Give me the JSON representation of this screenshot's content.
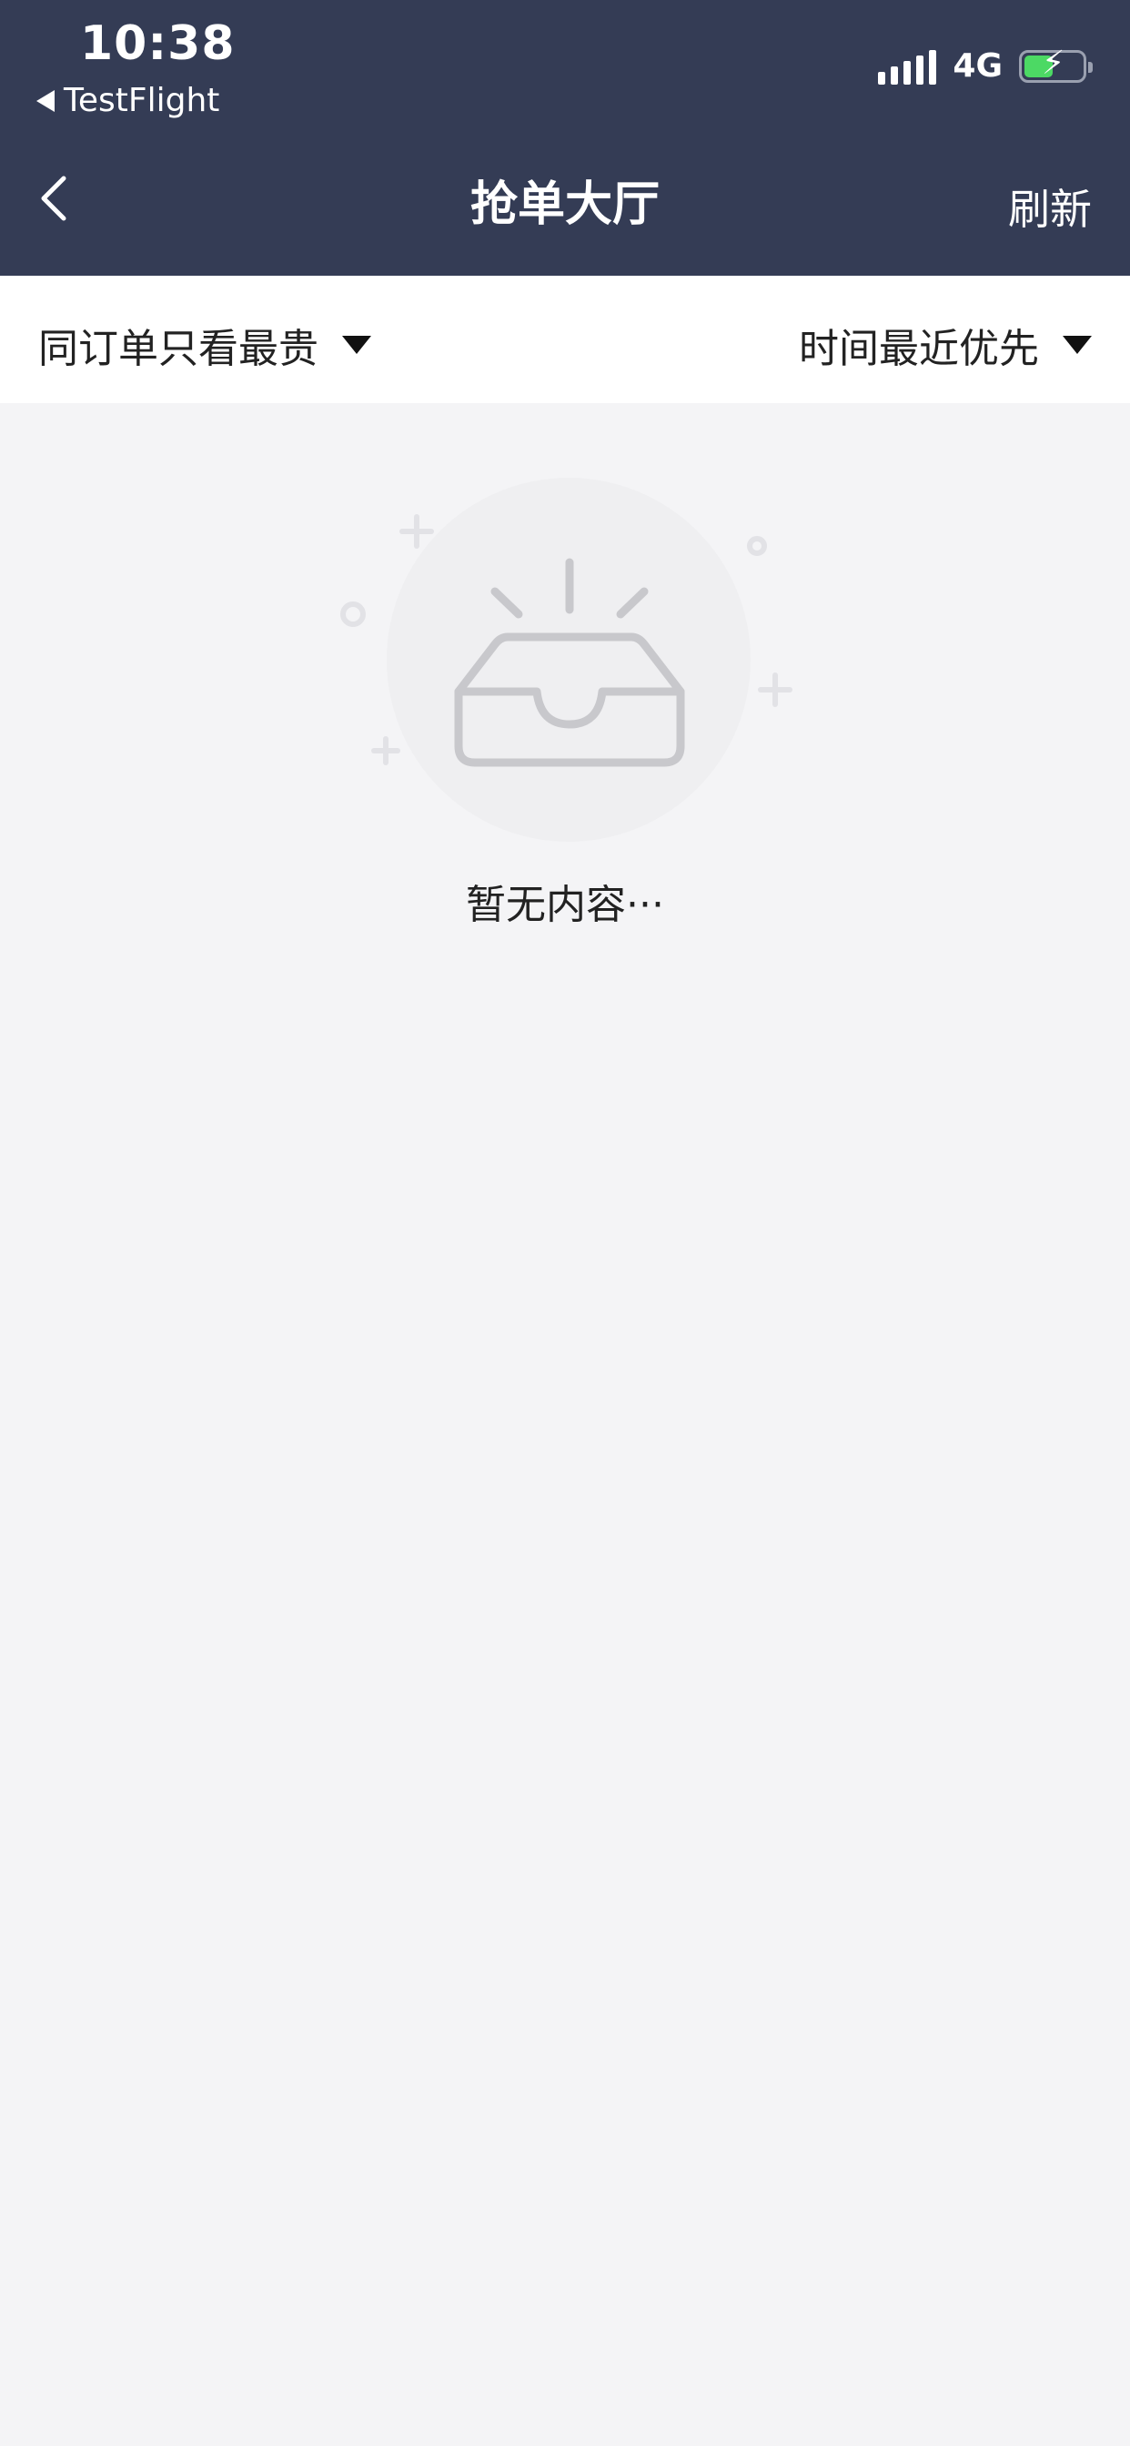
{
  "status_bar": {
    "time": "10:38",
    "back_app": "TestFlight",
    "network": "4G"
  },
  "nav": {
    "title": "抢单大厅",
    "refresh_label": "刷新"
  },
  "filters": {
    "left_label": "同订单只看最贵",
    "right_label": "时间最近优先"
  },
  "empty_state": {
    "message": "暂无内容···",
    "icon": "empty-inbox-icon"
  },
  "colors": {
    "header_bg": "#343c55",
    "page_bg": "#f4f4f6",
    "battery_green": "#4cd964"
  }
}
